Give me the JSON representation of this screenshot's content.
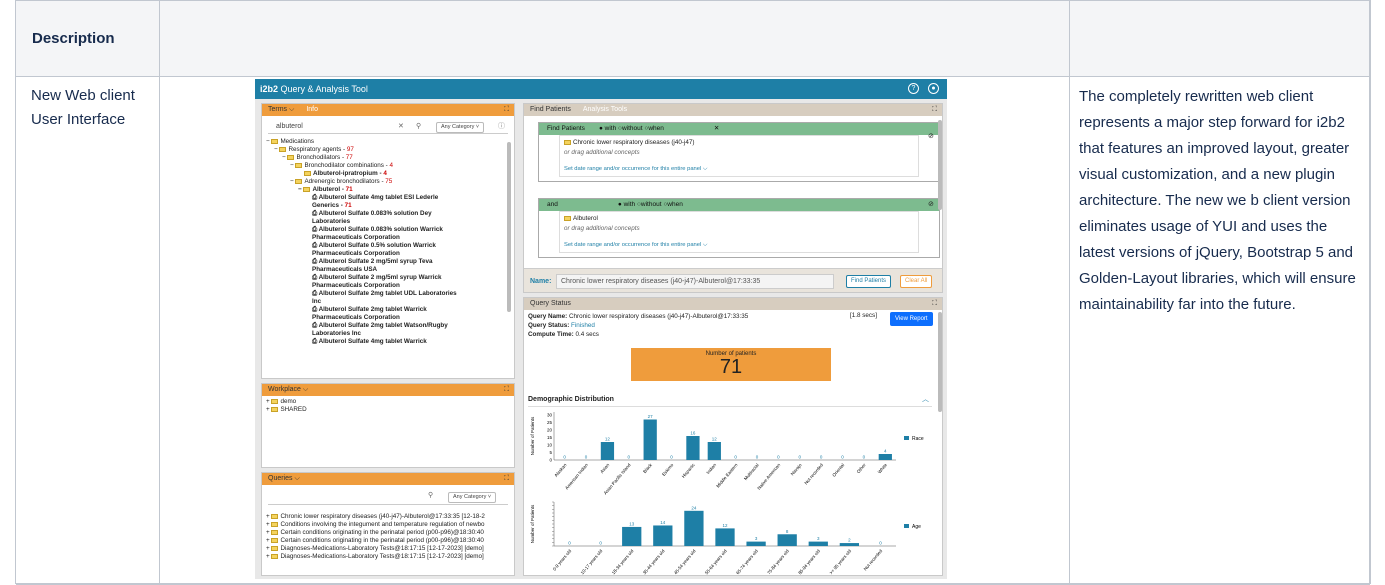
{
  "table": {
    "header_first": "Description",
    "header_second": "",
    "header_third": "",
    "row_label": "New Web client User Interface",
    "row_description": "The completely rewritten web client represents a major step forward for i2b2 that features an improved layout, greater visual customization,  and a new plugin architecture. The new we b client version eliminates usage of YUI and uses the latest versions of jQuery, Bootstrap 5 and Golden-Layout libraries, which will ensure maintainability far into the future."
  },
  "app": {
    "brand": "i2b2",
    "title": "Query & Analysis Tool",
    "help_icon": "?",
    "user_icon": "user"
  },
  "terms": {
    "tab": "Terms ⌵",
    "tab2": "Info",
    "search_value": "albuterol",
    "category": "Any Category ˅",
    "tree": [
      {
        "label": "Medications",
        "count": ""
      },
      {
        "label": "Respiratory agents - ",
        "count": "97"
      },
      {
        "label": "Bronchodilators - ",
        "count": "77"
      },
      {
        "label": "Bronchodilator combinations - ",
        "count": "4"
      },
      {
        "label": "Albuterol-ipratropium - ",
        "count": "4"
      },
      {
        "label": "Adrenergic bronchodilators - ",
        "count": "75"
      },
      {
        "label": "Albuterol - ",
        "count": "71"
      },
      {
        "label": "Albuterol Sulfate 4mg tablet ESI Lederle Generics - ",
        "count": "71"
      },
      {
        "label": "Albuterol Sulfate 0.083% solution Dey Laboratories",
        "count": ""
      },
      {
        "label": "Albuterol Sulfate 0.083% solution Warrick Pharmaceuticals Corporation",
        "count": ""
      },
      {
        "label": "Albuterol Sulfate 0.5% solution Warrick Pharmaceuticals Corporation",
        "count": ""
      },
      {
        "label": "Albuterol Sulfate 2 mg/5ml syrup Teva Pharmaceuticals USA",
        "count": ""
      },
      {
        "label": "Albuterol Sulfate 2 mg/5ml syrup Warrick Pharmaceuticals Corporation",
        "count": ""
      },
      {
        "label": "Albuterol Sulfate 2mg tablet UDL Laboratories Inc",
        "count": ""
      },
      {
        "label": "Albuterol Sulfate 2mg tablet Warrick Pharmaceuticals Corporation",
        "count": ""
      },
      {
        "label": "Albuterol Sulfate 2mg tablet Watson/Rugby Laboratories Inc",
        "count": ""
      },
      {
        "label": "Albuterol Sulfate 4mg tablet Warrick",
        "count": ""
      }
    ]
  },
  "workplace": {
    "tab": "Workplace ⌵",
    "items": [
      "demo",
      "SHARED"
    ]
  },
  "queries": {
    "tab": "Queries ⌵",
    "category": "Any Category ˅",
    "items": [
      "Chronic lower respiratory diseases (j40-j47)-Albuterol@17:33:35 [12-18-2",
      "Conditions involving the integument and temperature regulation of newbo",
      "Certain conditions originating in the perinatal period (p00-p96)@18:30:40",
      "Certain conditions originating in the perinatal period (p00-p96)@18:30:40",
      "Diagnoses-Medications-Laboratory Tests@18:17:15 [12-17-2023] [demo]",
      "Diagnoses-Medications-Laboratory Tests@18:17:15 [12-17-2023] [demo]"
    ]
  },
  "find": {
    "tab": "Find Patients",
    "tab2": "Analysis Tools",
    "panel1": {
      "title": "Find Patients",
      "with": "with",
      "without": "without",
      "when": "when",
      "concept": "Chronic lower respiratory diseases (j40-j47)",
      "drag": "or drag additional concepts",
      "date": "Set date range and/or occurrence for this entire panel ⌵"
    },
    "panel2": {
      "title": "and",
      "with": "with",
      "without": "without",
      "when": "when",
      "concept": "Albuterol",
      "drag": "or drag additional concepts",
      "date": "Set date range and/or occurrence for this entire panel ⌵"
    },
    "name_label": "Name:",
    "name_value": "Chronic lower respiratory diseases (j40-j47)-Albuterol@17:33:35",
    "find_btn": "Find Patients",
    "clear_btn": "Clear All"
  },
  "status": {
    "tab": "Query Status",
    "query_name_label": "Query Name:",
    "query_name": "Chronic lower respiratory diseases (j40-j47)-Albuterol@17:33:35",
    "secs": "[1.8  secs]",
    "view_btn": "View Report",
    "status_label": "Query Status:",
    "status_value": "Finished",
    "compute_label": "Compute Time:",
    "compute_value": "0.4  secs",
    "patients_label": "Number of patients",
    "patients_value": "71",
    "demo_title": "Demographic Distribution"
  },
  "chart_data": [
    {
      "type": "bar",
      "ylabel": "Number of Patients",
      "legend": "Race",
      "yticks": [
        0,
        5,
        10,
        15,
        20,
        25,
        30
      ],
      "ylim": [
        0,
        32
      ],
      "categories": [
        "Alaskan",
        "American Indian",
        "Asian",
        "Asian Pacific Island",
        "Black",
        "Eskimo",
        "Hispanic",
        "Indian",
        "Middle Eastern",
        "Multiracial",
        "Native American",
        "Navajo",
        "Not recorded",
        "Oriental",
        "Other",
        "White"
      ],
      "values": [
        0,
        0,
        12,
        0,
        27,
        0,
        16,
        12,
        0,
        0,
        0,
        0,
        0,
        0,
        0,
        4
      ]
    },
    {
      "type": "bar",
      "ylabel": "Number of Patients",
      "legend": "Age",
      "ylim": [
        0,
        30
      ],
      "categories": [
        "0-9 years old",
        "10-17 years old",
        "18-34 years old",
        "35-44 years old",
        "45-54 years old",
        "55-64 years old",
        "65-74 years old",
        "75-84 years old",
        "85-94 years old",
        ">= 95 years old",
        "Not recorded"
      ],
      "values": [
        0,
        0,
        13,
        14,
        24,
        12,
        3,
        8,
        3,
        2,
        0
      ]
    }
  ],
  "colors": {
    "accent": "#1e7fa6",
    "orange": "#ef9c3c",
    "green": "#7dbb8f"
  }
}
